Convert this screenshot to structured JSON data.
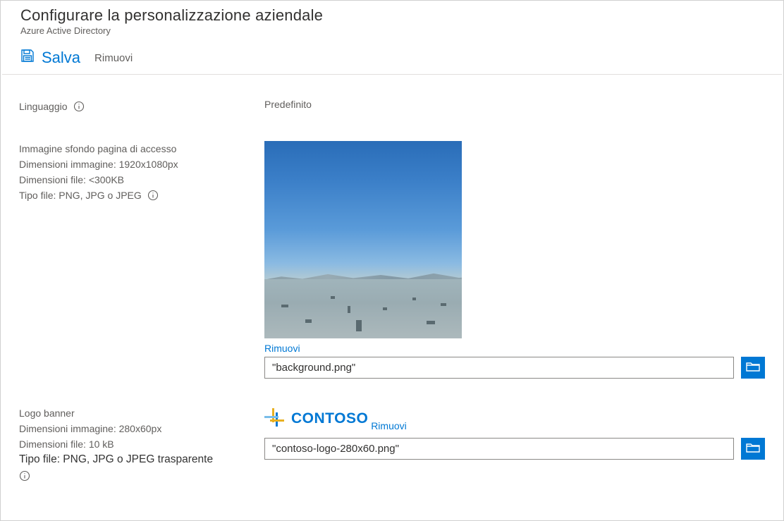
{
  "header": {
    "title": "Configurare la personalizzazione aziendale",
    "subtitle": "Azure Active Directory"
  },
  "toolbar": {
    "save_label": "Salva",
    "remove_label": "Rimuovi"
  },
  "language": {
    "label": "Linguaggio",
    "value": "Predefinito"
  },
  "background": {
    "section_label": "Immagine sfondo pagina di accesso",
    "dim_label": "Dimensioni immagine: 1920x1080px",
    "size_label": "Dimensioni file: <300KB",
    "type_label": "Tipo file: PNG, JPG o JPEG",
    "remove_link": "Rimuovi",
    "file_value": "\"background.png\""
  },
  "logo": {
    "section_label": "Logo banner",
    "dim_label": "Dimensioni immagine: 280x60px",
    "size_label": "Dimensioni file: 10 kB",
    "type_label": "Tipo file: PNG, JPG o JPEG trasparente",
    "brand_text": "CONTOSO",
    "remove_link": "Rimuovi",
    "file_value": "\"contoso-logo-280x60.png\""
  },
  "colors": {
    "accent": "#0078d4"
  }
}
